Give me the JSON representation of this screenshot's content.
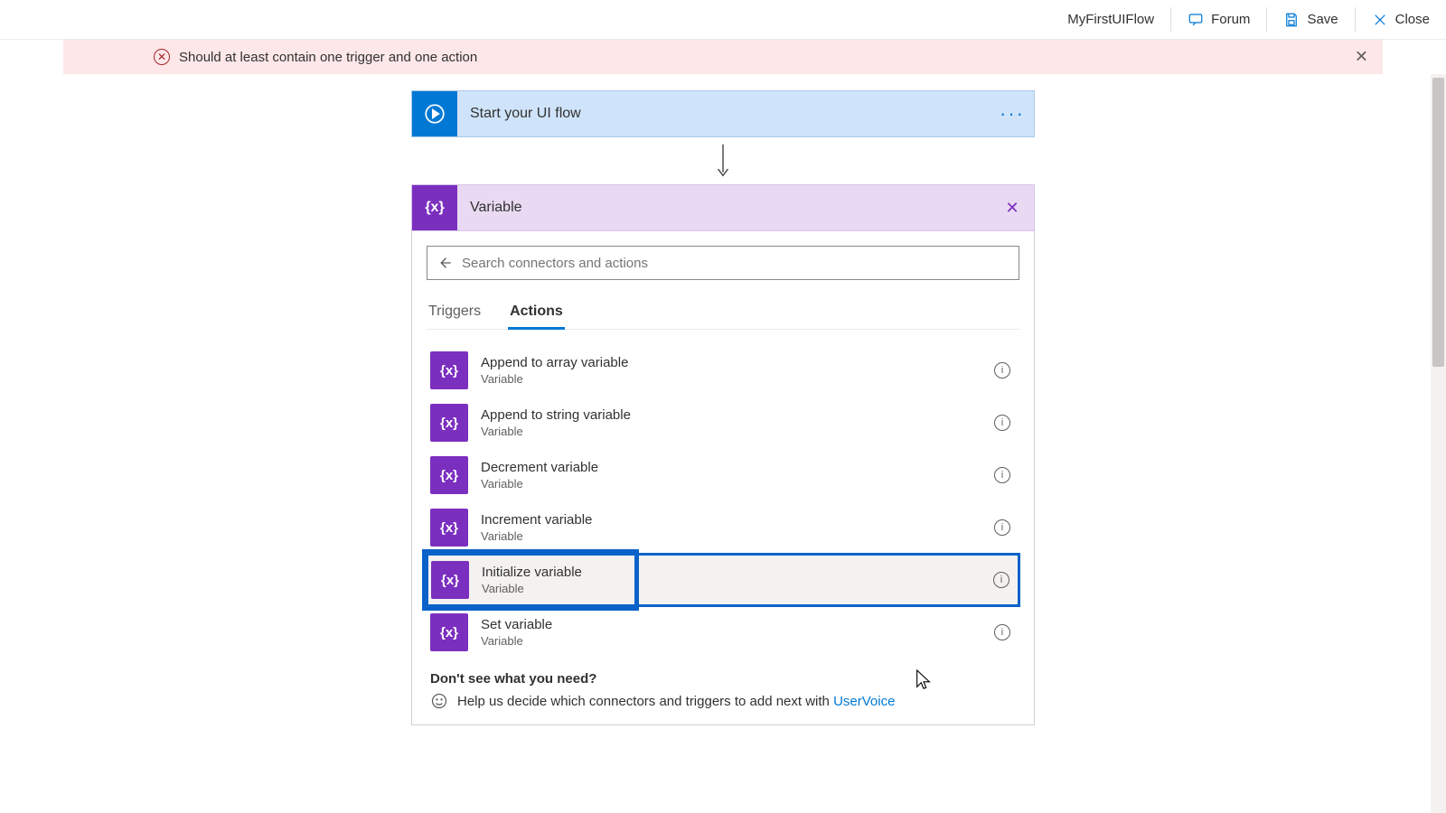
{
  "topbar": {
    "flow_name": "MyFirstUIFlow",
    "forum_label": "Forum",
    "save_label": "Save",
    "close_label": "Close"
  },
  "error_banner": {
    "text": "Should at least contain one trigger and one action"
  },
  "start_step": {
    "title": "Start your UI flow"
  },
  "variable_step": {
    "title": "Variable"
  },
  "search": {
    "placeholder": "Search connectors and actions"
  },
  "tabs": {
    "triggers_label": "Triggers",
    "actions_label": "Actions"
  },
  "actions": [
    {
      "title": "Append to array variable",
      "sub": "Variable"
    },
    {
      "title": "Append to string variable",
      "sub": "Variable"
    },
    {
      "title": "Decrement variable",
      "sub": "Variable"
    },
    {
      "title": "Increment variable",
      "sub": "Variable"
    },
    {
      "title": "Initialize variable",
      "sub": "Variable"
    },
    {
      "title": "Set variable",
      "sub": "Variable"
    }
  ],
  "footer": {
    "question": "Don't see what you need?",
    "help_prefix": "Help us decide which connectors and triggers to add next with ",
    "help_link": "UserVoice"
  },
  "icon_text": "{x}"
}
